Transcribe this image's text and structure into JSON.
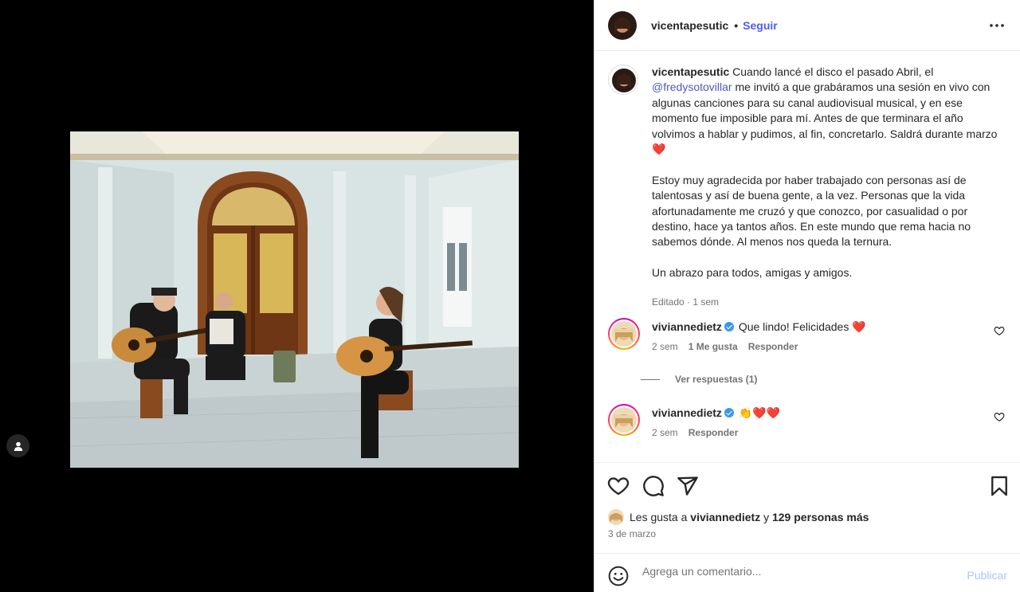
{
  "post": {
    "author": "vicentapesutic",
    "follow_label": "Seguir",
    "dot": "•"
  },
  "caption": {
    "username": "vicentapesutic",
    "text_before_mention": "Cuando lancé el disco el pasado Abril, el",
    "mention": "@fredysotovillar",
    "text_after_mention": "me invitó a que grabáramos una sesión en vivo con algunas canciones para su canal audiovisual musical, y en ese momento fue imposible para mí. Antes de que terminara el año volvimos a hablar y pudimos, al fin, concretarlo. Saldrá durante marzo",
    "heart_emoji": "❤️",
    "paragraph2": "Estoy muy agradecida por haber trabajado con personas así de talentosas y así de buena gente, a la vez. Personas que la vida afortunadamente me cruzó y que conozco, por casualidad o por destino, hace ya tantos años. En este mundo que rema hacia no sabemos dónde. Al menos nos queda la ternura.",
    "paragraph3": "Un abrazo para todos, amigas y amigos.",
    "meta": "Editado · 1 sem"
  },
  "comments": [
    {
      "username": "viviannedietz",
      "text": "Que lindo! Felicidades",
      "emoji": "❤️",
      "time": "2 sem",
      "likes": "1 Me gusta",
      "reply_label": "Responder",
      "view_replies": "Ver respuestas (1)"
    },
    {
      "username": "viviannedietz",
      "text": "",
      "emoji": "👏❤️❤️",
      "time": "2 sem",
      "reply_label": "Responder"
    }
  ],
  "likes": {
    "prefix": "Les gusta a",
    "user": "viviannedietz",
    "joiner": "y",
    "others": "129 personas más"
  },
  "date": "3 de marzo",
  "add_comment": {
    "placeholder": "Agrega un comentario...",
    "publish_label": "Publicar"
  },
  "colors": {
    "link": "#4a5df9",
    "mention": "#4c59c7",
    "publish_disabled": "#a4c8f5",
    "verified": "#3897f0"
  }
}
